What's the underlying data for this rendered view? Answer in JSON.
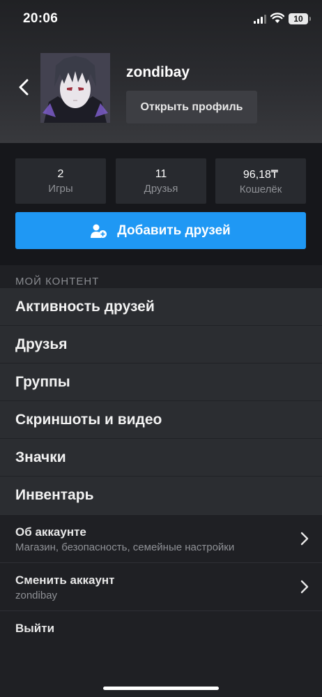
{
  "status_bar": {
    "time": "20:06",
    "battery": "10",
    "signal_icon": "cellular-signal-icon",
    "wifi_icon": "wifi-icon"
  },
  "header": {
    "back_icon": "chevron-left-icon",
    "username": "zondibay",
    "open_profile_label": "Открыть профиль"
  },
  "stats": [
    {
      "value": "2",
      "label": "Игры"
    },
    {
      "value": "11",
      "label": "Друзья"
    },
    {
      "value": "96,18₸",
      "label": "Кошелёк"
    }
  ],
  "add_friends": {
    "label": "Добавить друзей",
    "icon": "add-user-icon",
    "color": "#1f98f4"
  },
  "my_content": {
    "section_label": "МОЙ КОНТЕНТ",
    "items": [
      {
        "label": "Активность друзей"
      },
      {
        "label": "Друзья"
      },
      {
        "label": "Группы"
      },
      {
        "label": "Скриншоты и видео"
      },
      {
        "label": "Значки"
      },
      {
        "label": "Инвентарь"
      }
    ]
  },
  "account": {
    "title": "Об аккаунте",
    "subtitle": "Магазин, безопасность, семейные настройки"
  },
  "switch_account": {
    "title": "Сменить аккаунт",
    "subtitle": "zondibay"
  },
  "logout_label": "Выйти"
}
